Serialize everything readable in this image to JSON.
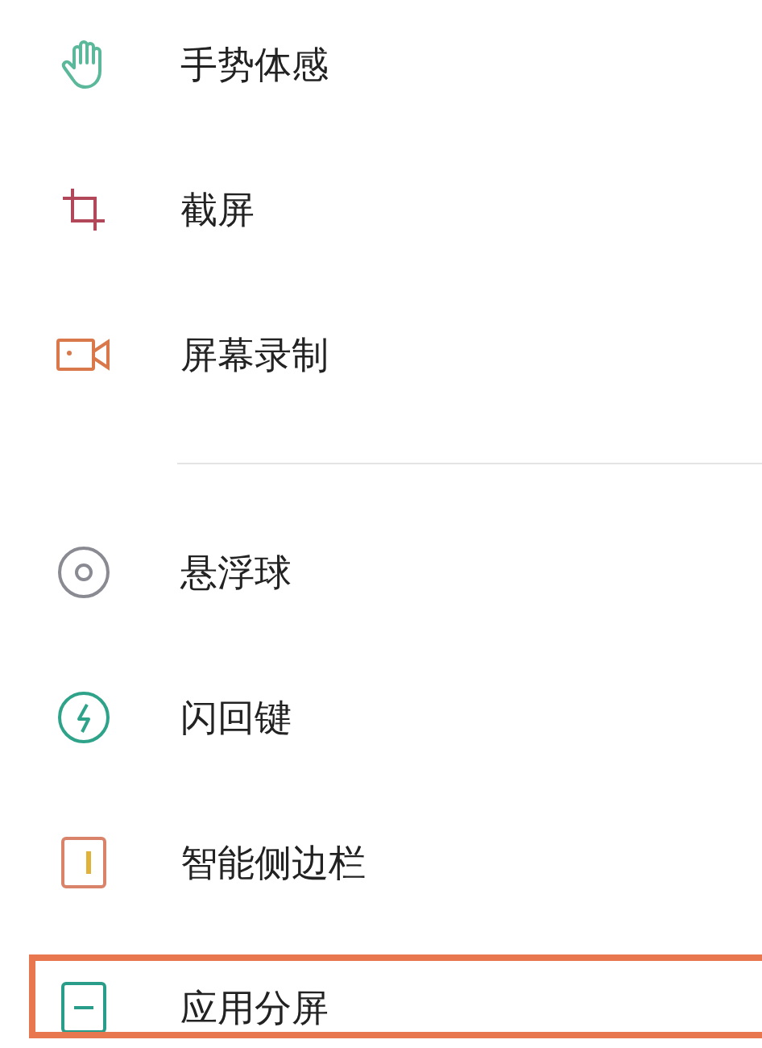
{
  "groups": [
    {
      "items": [
        {
          "kind": "gesture",
          "label": "手势体感",
          "highlighted": false
        },
        {
          "kind": "screenshot",
          "label": "截屏",
          "highlighted": false
        },
        {
          "kind": "record",
          "label": "屏幕录制",
          "highlighted": false
        }
      ]
    },
    {
      "items": [
        {
          "kind": "ball",
          "label": "悬浮球",
          "highlighted": false
        },
        {
          "kind": "flash",
          "label": "闪回键",
          "highlighted": false
        },
        {
          "kind": "sidebar",
          "label": "智能侧边栏",
          "highlighted": false
        },
        {
          "kind": "split",
          "label": "应用分屏",
          "highlighted": true
        }
      ]
    }
  ]
}
